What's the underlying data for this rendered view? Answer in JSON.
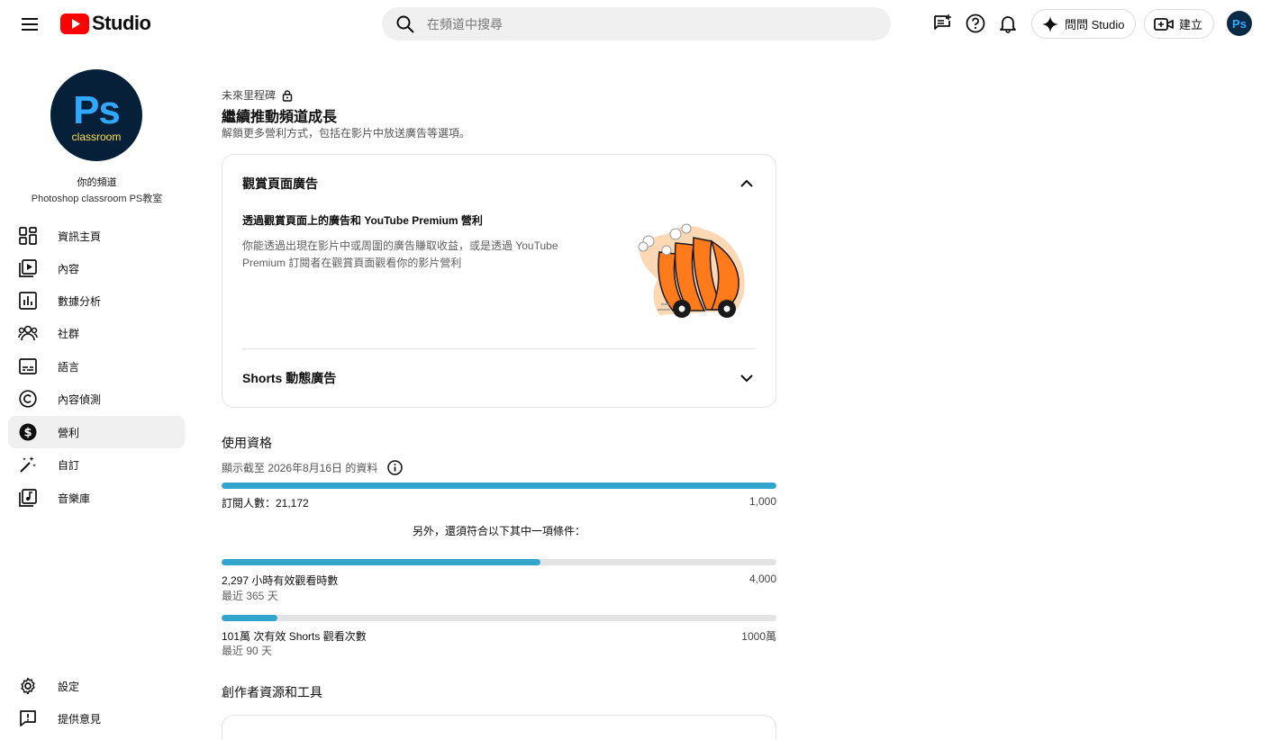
{
  "header": {
    "brand": "Studio",
    "search_placeholder": "在頻道中搜尋",
    "ask_studio_label": "問問 Studio",
    "create_label": "建立",
    "account_initials": "Ps"
  },
  "channel": {
    "avatar_text": "Ps",
    "avatar_subtext": "classroom",
    "label": "你的頻道",
    "name": "Photoshop classroom PS教室"
  },
  "nav": {
    "items": [
      {
        "label": "資訊主頁",
        "icon": "dashboard-icon"
      },
      {
        "label": "內容",
        "icon": "content-icon"
      },
      {
        "label": "數據分析",
        "icon": "analytics-icon"
      },
      {
        "label": "社群",
        "icon": "community-icon"
      },
      {
        "label": "語言",
        "icon": "subtitles-icon"
      },
      {
        "label": "內容偵測",
        "icon": "copyright-icon"
      },
      {
        "label": "營利",
        "icon": "monetization-icon",
        "active": true
      },
      {
        "label": "自訂",
        "icon": "customization-icon"
      },
      {
        "label": "音樂庫",
        "icon": "audio-library-icon"
      }
    ],
    "bottom": [
      {
        "label": "設定",
        "icon": "settings-icon"
      },
      {
        "label": "提供意見",
        "icon": "feedback-icon"
      }
    ]
  },
  "milestone": {
    "eyebrow": "未來里程碑",
    "title": "繼續推動頻道成長",
    "subtitle": "解鎖更多營利方式，包括在影片中放送廣告等選項。"
  },
  "ads_card": {
    "heading": "觀賞頁面廣告",
    "subheading": "透過觀賞頁面上的廣告和 YouTube Premium 營利",
    "description": "你能透過出現在影片中或周圍的廣告賺取收益，或是透過 YouTube Premium 訂閱者在觀賞頁面觀看你的影片營利",
    "shorts_heading": "Shorts 動態廣告"
  },
  "eligibility": {
    "title": "使用資格",
    "date_note": "顯示截至 2026年8月16日 的資料",
    "subscribers": {
      "label": "訂閱人數：21,172",
      "target": "1,000",
      "progress": 1.0
    },
    "also_text": "另外，還須符合以下其中一項條件：",
    "watch_hours": {
      "label": "2,297 小時有效觀看時數",
      "target": "4,000",
      "period": "最近 365 天",
      "progress": 0.574
    },
    "shorts_views": {
      "label": "101萬 次有效 Shorts 觀看次數",
      "target": "1000萬",
      "period": "最近 90 天",
      "progress": 0.101
    }
  },
  "tools": {
    "title": "創作者資源和工具"
  },
  "colors": {
    "accent": "#32a5cd",
    "youtube_red": "#ff0000",
    "illustration_orange": "#ff7a1a"
  }
}
